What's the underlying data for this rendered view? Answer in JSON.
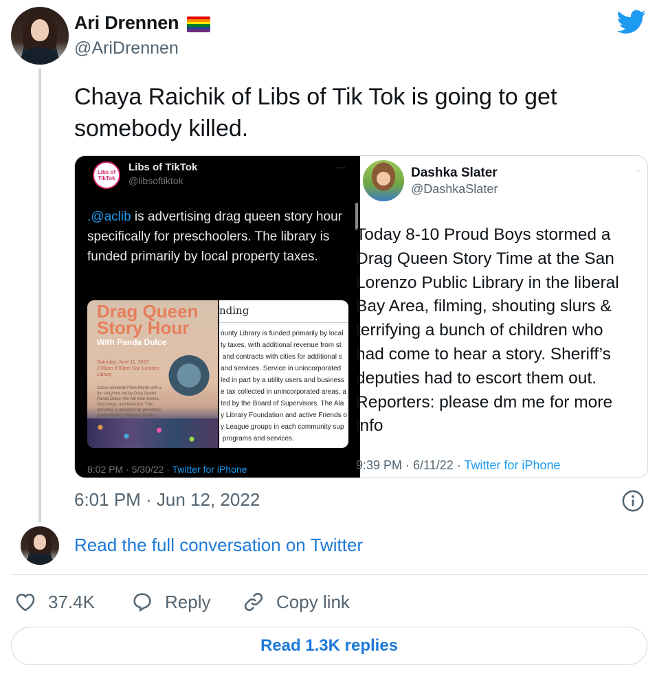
{
  "author": {
    "name": "Ari Drennen",
    "handle": "@AriDrennen",
    "flag_colors": [
      "#e40303",
      "#ff8c00",
      "#ffed00",
      "#008026",
      "#24408e",
      "#732982"
    ]
  },
  "tweet": {
    "text": "Chaya Raichik of Libs of Tik Tok is going to get somebody killed.",
    "timestamp": "6:01 PM · Jun 12, 2022"
  },
  "embedded_left": {
    "logo_text": "Libs of TikTok",
    "name": "Libs of TikTok",
    "handle": "@libsoftiktok",
    "dots": "···",
    "mention": ".@aclib",
    "text_rest": " is advertising drag queen story hour specifically for preschoolers. The library is funded primarily by local property taxes.",
    "poster_title": "Drag Queen Story Hour",
    "poster_subtitle": "With Panda Dulce",
    "poster_date": "Saturday, June 11, 2022 2:00pm-3:00pm San Lorenzo Library",
    "poster_desc": "Come celebrate Pride Month with a fun storytime led by Drag Queen Panda Dulce! We will hear stories, sing songs, and have fun. This storytime is designed for preschool aged children. However, all are welcome.",
    "doc_heading": "nding",
    "doc_body": "ounty Library is funded primarily by local\nty taxes, with additional revenue from st\n and contracts with cities for additional s\nand services. Service in unincorporated\nled in part by a utility users and business\ne tax collected in unincorporated areas, a\nted by the Board of Supervisors. The Ala\ny Library Foundation and active Friends o\ny League groups in each community sup\n programs and services.",
    "footer_time": "8:02 PM · 5/30/22 · ",
    "footer_source": "Twitter for iPhone"
  },
  "embedded_right": {
    "name": "Dashka Slater",
    "handle": "@DashkaSlater",
    "dots": "··",
    "text": "Today 8-10 Proud Boys stormed a\nDrag Queen Story Time at the San\nLorenzo Public Library in the liberal\nBay Area, filming, shouting slurs &\nterrifying a bunch of children who\nhad come to hear a story. Sheriff’s\ndeputies had to escort them out.\nReporters: please dm me for more\ninfo",
    "footer_time": "9:39 PM · 6/11/22 · ",
    "footer_source": "Twitter for iPhone"
  },
  "conversation_link": "Read the full conversation on Twitter",
  "actions": {
    "likes": "37.4K",
    "reply": "Reply",
    "copy_link": "Copy link"
  },
  "replies_button": "Read 1.3K replies",
  "colors": {
    "link_blue": "#1d7ad8",
    "twitter_blue": "#1d9bf0",
    "secondary_text": "#536471",
    "border": "#cfd9de"
  }
}
